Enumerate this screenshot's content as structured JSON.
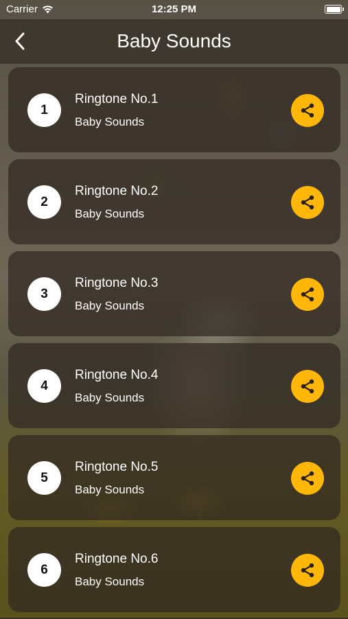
{
  "status_bar": {
    "carrier": "Carrier",
    "time": "12:25 PM",
    "battery_level": 1.0
  },
  "nav": {
    "title": "Baby Sounds",
    "back_icon": "chevron-left-icon"
  },
  "list": {
    "items": [
      {
        "number": "1",
        "title": "Ringtone No.1",
        "subtitle": "Baby Sounds"
      },
      {
        "number": "2",
        "title": "Ringtone No.2",
        "subtitle": "Baby Sounds"
      },
      {
        "number": "3",
        "title": "Ringtone No.3",
        "subtitle": "Baby Sounds"
      },
      {
        "number": "4",
        "title": "Ringtone No.4",
        "subtitle": "Baby Sounds"
      },
      {
        "number": "5",
        "title": "Ringtone No.5",
        "subtitle": "Baby Sounds"
      },
      {
        "number": "6",
        "title": "Ringtone No.6",
        "subtitle": "Baby Sounds"
      }
    ],
    "share_icon": "share-icon"
  },
  "colors": {
    "accent": "#ffb80a",
    "card": "#30281f",
    "text": "#ffffff"
  }
}
